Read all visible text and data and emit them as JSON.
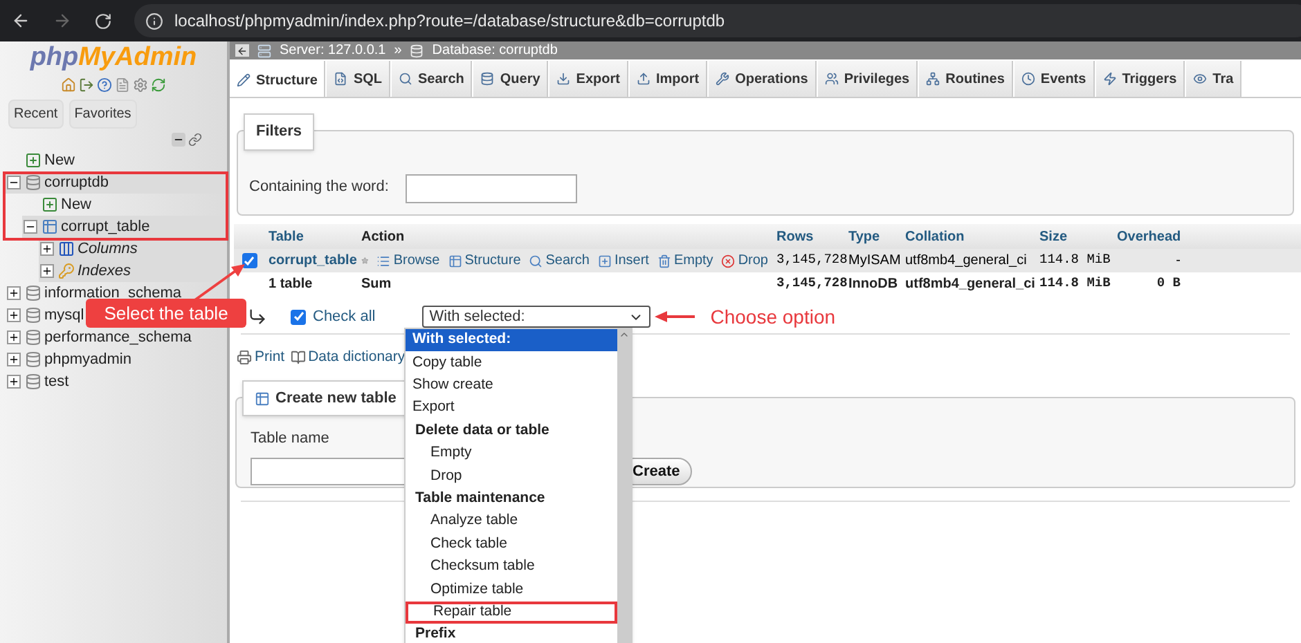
{
  "browser": {
    "url": "localhost/phpmyadmin/index.php?route=/database/structure&db=corruptdb"
  },
  "sidebar": {
    "logo": [
      "php",
      "MyAdmin"
    ],
    "buttons": [
      "Recent",
      "Favorites"
    ],
    "highlight_frame": true,
    "tree": [
      {
        "kind": "new",
        "label": "New",
        "selected": false
      },
      {
        "kind": "db",
        "label": "corruptdb",
        "expanded": true,
        "selected": true,
        "children": [
          {
            "kind": "new",
            "label": "New",
            "selected": false
          },
          {
            "kind": "table",
            "label": "corrupt_table",
            "expanded": true,
            "selected": true,
            "children": [
              {
                "kind": "columns",
                "label": "Columns",
                "expanded": false,
                "selected": true
              },
              {
                "kind": "indexes",
                "label": "Indexes",
                "expanded": false,
                "selected": true
              }
            ]
          }
        ]
      },
      {
        "kind": "db",
        "label": "information_schema",
        "expanded": false,
        "selected": false
      },
      {
        "kind": "db",
        "label": "mysql",
        "expanded": false,
        "selected": false
      },
      {
        "kind": "db",
        "label": "performance_schema",
        "expanded": false,
        "selected": false
      },
      {
        "kind": "db",
        "label": "phpmyadmin",
        "expanded": false,
        "selected": false
      },
      {
        "kind": "db",
        "label": "test",
        "expanded": false,
        "selected": false
      }
    ]
  },
  "breadcrumb": {
    "items": [
      "Server: 127.0.0.1",
      "Database: corruptdb"
    ],
    "separator": "»"
  },
  "tabs": [
    {
      "label": "Structure",
      "selected": true
    },
    {
      "label": "SQL",
      "selected": false
    },
    {
      "label": "Search",
      "selected": false
    },
    {
      "label": "Query",
      "selected": false
    },
    {
      "label": "Export",
      "selected": false
    },
    {
      "label": "Import",
      "selected": false
    },
    {
      "label": "Operations",
      "selected": false
    },
    {
      "label": "Privileges",
      "selected": false
    },
    {
      "label": "Routines",
      "selected": false
    },
    {
      "label": "Events",
      "selected": false
    },
    {
      "label": "Triggers",
      "selected": false
    },
    {
      "label": "Tra",
      "selected": false
    }
  ],
  "filters": {
    "legend": "Filters",
    "label": "Containing the word:"
  },
  "table": {
    "columns": [
      "Table",
      "Action",
      "Rows",
      "Type",
      "Collation",
      "Size",
      "Overhead"
    ],
    "rows": [
      {
        "checked": true,
        "name": "corrupt_table",
        "actions": [
          "Browse",
          "Structure",
          "Search",
          "Insert",
          "Empty",
          "Drop"
        ],
        "rows": "3,145,728",
        "type": "MyISAM",
        "collation": "utf8mb4_general_ci",
        "size": "114.8 MiB",
        "overhead": "-"
      }
    ],
    "footer": {
      "name": "1 table",
      "action": "Sum",
      "rows": "3,145,728",
      "type": "InnoDB",
      "collation": "utf8mb4_general_ci",
      "size": "114.8 MiB",
      "overhead": "0 B"
    }
  },
  "bulk": {
    "check_all": {
      "label": "Check all",
      "checked": true
    },
    "select_value": "With selected:"
  },
  "links": [
    "Print",
    "Data dictionary"
  ],
  "create": {
    "legend": "Create new table",
    "label": "Table name",
    "button": "Create"
  },
  "dropdown": [
    {
      "kind": "option",
      "label": "With selected:",
      "selected": true,
      "boxed": false
    },
    {
      "kind": "option",
      "label": "Copy table",
      "selected": false,
      "boxed": false
    },
    {
      "kind": "option",
      "label": "Show create",
      "selected": false,
      "boxed": false
    },
    {
      "kind": "option",
      "label": "Export",
      "selected": false,
      "boxed": false
    },
    {
      "kind": "group",
      "label": "Delete data or table",
      "selected": false,
      "boxed": false
    },
    {
      "kind": "suboption",
      "label": "Empty",
      "selected": false,
      "boxed": false
    },
    {
      "kind": "suboption",
      "label": "Drop",
      "selected": false,
      "boxed": false
    },
    {
      "kind": "group",
      "label": "Table maintenance",
      "selected": false,
      "boxed": false
    },
    {
      "kind": "suboption",
      "label": "Analyze table",
      "selected": false,
      "boxed": false
    },
    {
      "kind": "suboption",
      "label": "Check table",
      "selected": false,
      "boxed": false
    },
    {
      "kind": "suboption",
      "label": "Checksum table",
      "selected": false,
      "boxed": false
    },
    {
      "kind": "suboption",
      "label": "Optimize table",
      "selected": false,
      "boxed": false
    },
    {
      "kind": "suboption",
      "label": "Repair table",
      "selected": false,
      "boxed": true
    },
    {
      "kind": "group",
      "label": "Prefix",
      "selected": false,
      "boxed": false
    }
  ],
  "annotations": [
    {
      "kind": "callout",
      "text": "Select the table"
    },
    {
      "kind": "label",
      "text": "Choose option"
    }
  ]
}
